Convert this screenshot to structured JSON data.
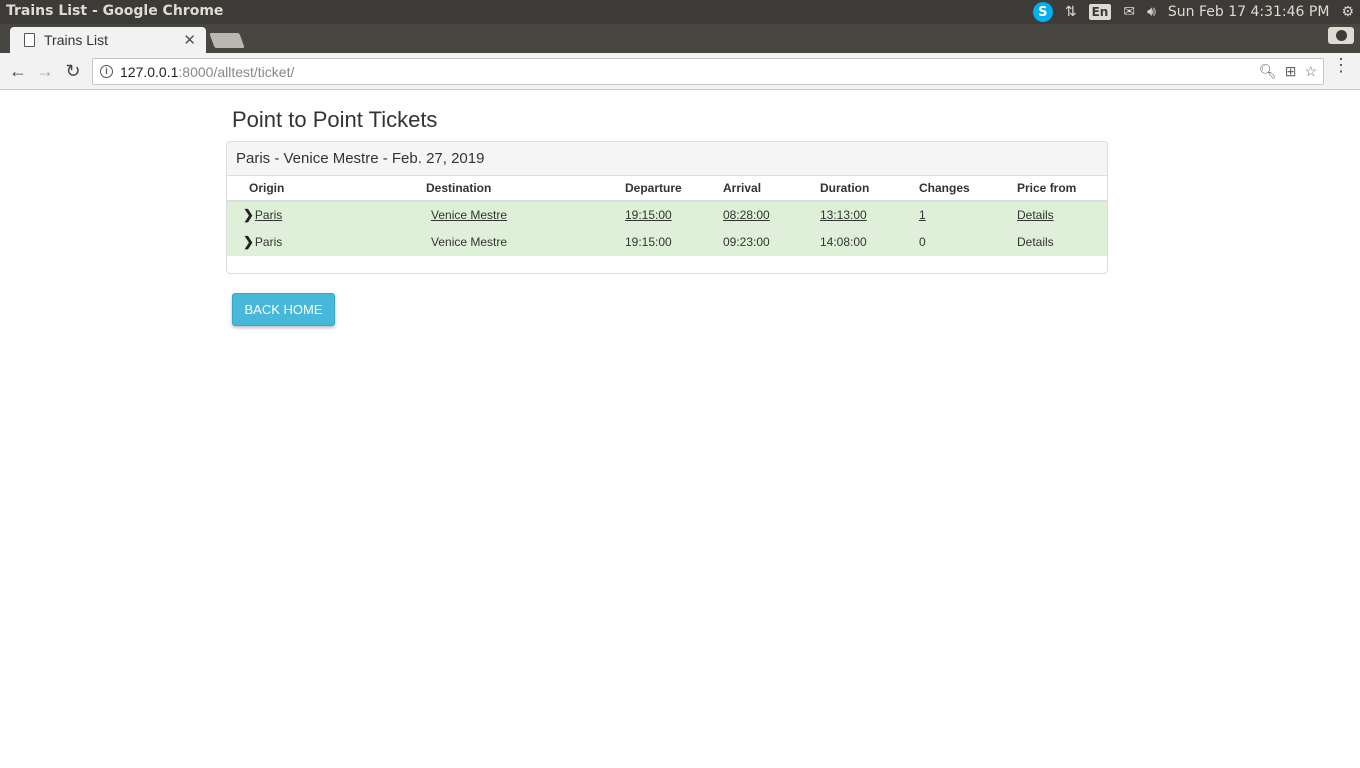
{
  "os": {
    "window_title": "Trains List - Google Chrome",
    "lang": "En",
    "clock": "Sun Feb 17  4:31:46 PM"
  },
  "browser": {
    "tab_title": "Trains List",
    "url_host": "127.0.0.1",
    "url_rest": ":8000/alltest/ticket/"
  },
  "page": {
    "heading": "Point to Point Tickets",
    "panel_title": "Paris - Venice Mestre - Feb. 27, 2019",
    "columns": [
      "Origin",
      "Destination",
      "Departure",
      "Arrival",
      "Duration",
      "Changes",
      "Price from"
    ],
    "rows": [
      {
        "origin": "Paris",
        "destination": "Venice Mestre",
        "departure": "19:15:00",
        "arrival": "08:28:00",
        "duration": "13:13:00",
        "changes": "1",
        "price": "Details"
      },
      {
        "origin": "Paris",
        "destination": "Venice Mestre",
        "departure": "19:15:00",
        "arrival": "09:23:00",
        "duration": "14:08:00",
        "changes": "0",
        "price": "Details"
      }
    ],
    "back_button": "BACK HOME"
  }
}
